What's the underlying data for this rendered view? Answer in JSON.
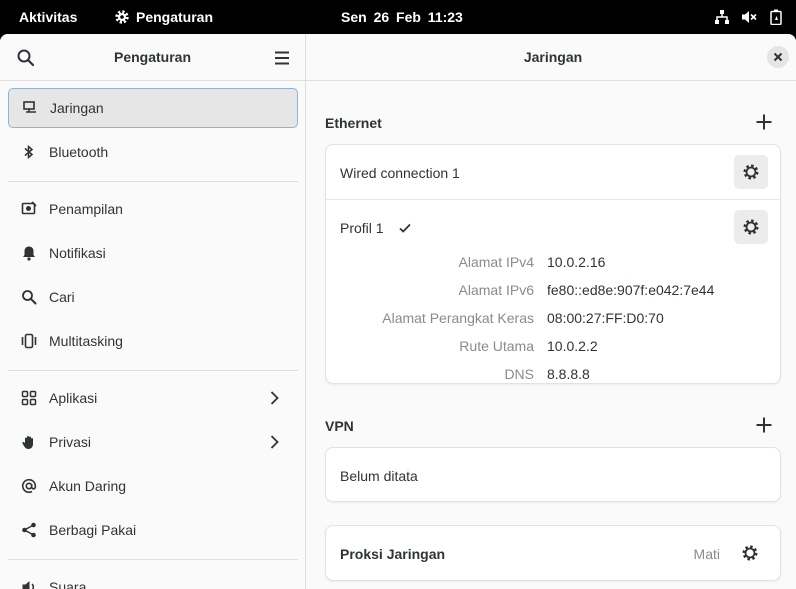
{
  "topbar": {
    "activities": "Aktivitas",
    "app_name": "Pengaturan",
    "clock": "Sen 26 Feb  11:23"
  },
  "sidebar": {
    "title": "Pengaturan",
    "items": [
      {
        "label": "Jaringan",
        "icon": "network-icon"
      },
      {
        "label": "Bluetooth",
        "icon": "bluetooth-icon"
      },
      {
        "label": "Penampilan",
        "icon": "appearance-icon"
      },
      {
        "label": "Notifikasi",
        "icon": "bell-icon"
      },
      {
        "label": "Cari",
        "icon": "search-icon"
      },
      {
        "label": "Multitasking",
        "icon": "multitasking-icon"
      },
      {
        "label": "Aplikasi",
        "icon": "apps-grid-icon"
      },
      {
        "label": "Privasi",
        "icon": "hand-icon"
      },
      {
        "label": "Akun Daring",
        "icon": "at-icon"
      },
      {
        "label": "Berbagi Pakai",
        "icon": "share-icon"
      },
      {
        "label": "Suara",
        "icon": "speaker-icon"
      }
    ]
  },
  "content": {
    "title": "Jaringan",
    "ethernet": {
      "title": "Ethernet",
      "connection": "Wired connection 1",
      "profile": "Profil 1",
      "details": [
        {
          "key": "Alamat IPv4",
          "value": "10.0.2.16"
        },
        {
          "key": "Alamat IPv6",
          "value": "fe80::ed8e:907f:e042:7e44"
        },
        {
          "key": "Alamat Perangkat Keras",
          "value": "08:00:27:FF:D0:70"
        },
        {
          "key": "Rute Utama",
          "value": "10.0.2.2"
        },
        {
          "key": "DNS",
          "value": "8.8.8.8"
        }
      ]
    },
    "vpn": {
      "title": "VPN",
      "empty": "Belum ditata"
    },
    "proxy": {
      "title": "Proksi Jaringan",
      "status": "Mati"
    }
  },
  "colors": {
    "accent_border": "#8fb2d9",
    "topbar_bg": "#000000",
    "active_bg": "#e6e6e6"
  }
}
